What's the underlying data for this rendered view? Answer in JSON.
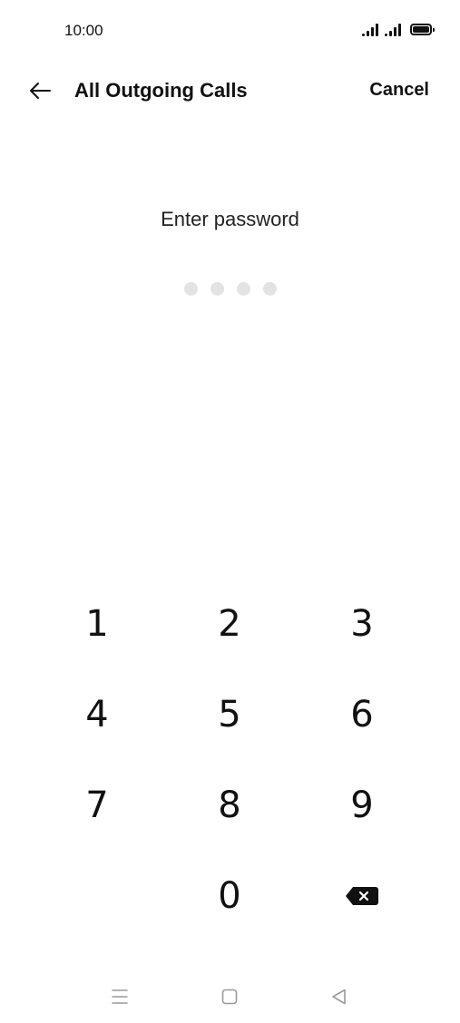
{
  "status_bar": {
    "time": "10:00",
    "icons": [
      "signal-icon",
      "signal-icon",
      "battery-icon"
    ]
  },
  "header": {
    "title": "All Outgoing Calls",
    "cancel_label": "Cancel",
    "back_icon": "arrow-left-icon"
  },
  "password": {
    "prompt": "Enter password",
    "length": 4,
    "entered": 0
  },
  "keypad": {
    "keys": [
      "1",
      "2",
      "3",
      "4",
      "5",
      "6",
      "7",
      "8",
      "9",
      "",
      "0",
      "backspace-icon"
    ]
  },
  "nav_bar": {
    "icons": [
      "menu-icon",
      "home-icon",
      "back-icon"
    ]
  },
  "colors": {
    "background": "#ffffff",
    "text": "#111111",
    "pin_dot_empty": "#e3e3e3",
    "nav_icon": "#9a9a9a"
  }
}
